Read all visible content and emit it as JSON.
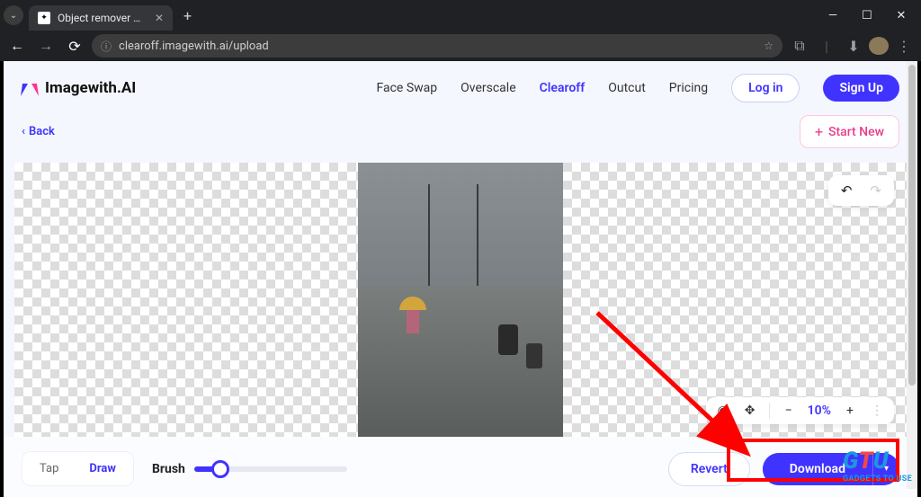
{
  "browser": {
    "tab_title": "Object remover AI - Remove ob",
    "url": "clearoff.imagewith.ai/upload"
  },
  "header": {
    "brand": "Imagewith.AI",
    "nav": {
      "face_swap": "Face Swap",
      "overscale": "Overscale",
      "clearoff": "Clearoff",
      "outcut": "Outcut",
      "pricing": "Pricing"
    },
    "login": "Log in",
    "signup": "Sign Up"
  },
  "subheader": {
    "back": "Back",
    "start_new": "Start New"
  },
  "canvas": {
    "zoom": "10%"
  },
  "toolbar": {
    "tap": "Tap",
    "draw": "Draw",
    "brush": "Brush",
    "revert": "Revert",
    "download": "Download"
  },
  "watermark": "GADGETS TO USE"
}
